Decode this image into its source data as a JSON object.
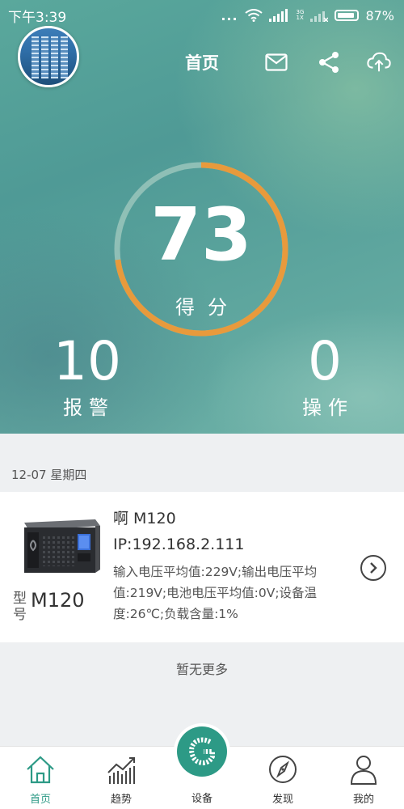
{
  "status_bar": {
    "time": "下午3:39",
    "dots": "...",
    "net_top": "3G",
    "net_bottom": "1X",
    "battery": "87%"
  },
  "header": {
    "title": "首页",
    "icons": [
      "mail-icon",
      "share-icon",
      "cloud-upload-icon"
    ]
  },
  "score": {
    "value": "73",
    "label": "得分",
    "fraction": 0.73,
    "ring_color": "#e89a3c",
    "track_color": "#a8c9c2"
  },
  "stats": {
    "alarm": {
      "value": "10",
      "label": "报警"
    },
    "operations": {
      "value": "0",
      "label": "操作"
    }
  },
  "date_header": "12-07 星期四",
  "device": {
    "name": "啊 M120",
    "ip": "IP:192.168.2.111",
    "description": "输入电压平均值:229V;输出电压平均值:219V;电池电压平均值:0V;设备温度:26℃;负载含量:1%",
    "model_prefix": "型号",
    "model_value": "M120"
  },
  "no_more": "暂无更多",
  "tabs": [
    {
      "label": "首页",
      "icon": "home-icon",
      "active": true
    },
    {
      "label": "趋势",
      "icon": "trend-chart-icon",
      "active": false
    },
    {
      "label": "设备",
      "icon": "device-logo-icon",
      "active": false
    },
    {
      "label": "发现",
      "icon": "compass-icon",
      "active": false
    },
    {
      "label": "我的",
      "icon": "person-icon",
      "active": false
    }
  ],
  "colors": {
    "accent": "#2d9a86",
    "score_ring": "#e89a3c"
  }
}
